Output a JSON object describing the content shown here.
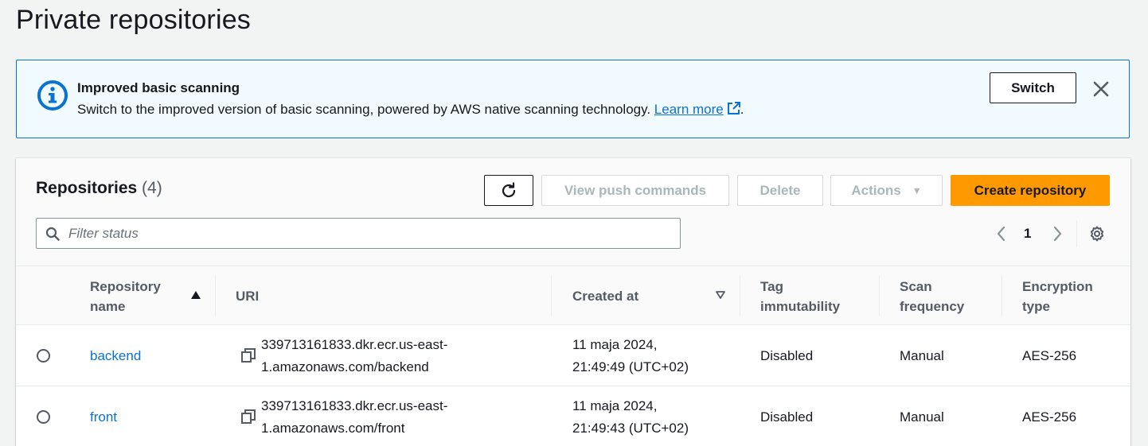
{
  "page": {
    "title": "Private repositories"
  },
  "flash": {
    "title": "Improved basic scanning",
    "body": "Switch to the improved version of basic scanning, powered by AWS native scanning technology.",
    "link": "Learn more",
    "trailing": ".",
    "switch_label": "Switch",
    "icon": "info-icon",
    "accent": "#0972d3"
  },
  "panel": {
    "title": "Repositories",
    "count": "(4)",
    "buttons": {
      "push": "View push commands",
      "delete": "Delete",
      "actions": "Actions",
      "create": "Create repository"
    },
    "filter_placeholder": "Filter status",
    "page_number": "1",
    "primary_color": "#ff9900"
  },
  "table": {
    "headers": {
      "name_line1": "Repository",
      "name_line2": "name",
      "uri": "URI",
      "created": "Created at",
      "tag_line1": "Tag",
      "tag_line2": "immutability",
      "scan_line1": "Scan",
      "scan_line2": "frequency",
      "enc_line1": "Encryption",
      "enc_line2": "type"
    },
    "rows": [
      {
        "name": "backend",
        "uri_line1": "339713161833.dkr.ecr.us-east-",
        "uri_line2": "1.amazonaws.com/backend",
        "created_line1": "11 maja 2024,",
        "created_line2": "21:49:49 (UTC+02)",
        "tag_immutability": "Disabled",
        "scan_frequency": "Manual",
        "encryption": "AES-256"
      },
      {
        "name": "front",
        "uri_line1": "339713161833.dkr.ecr.us-east-",
        "uri_line2": "1.amazonaws.com/front",
        "created_line1": "11 maja 2024,",
        "created_line2": "21:49:43 (UTC+02)",
        "tag_immutability": "Disabled",
        "scan_frequency": "Manual",
        "encryption": "AES-256"
      }
    ]
  }
}
